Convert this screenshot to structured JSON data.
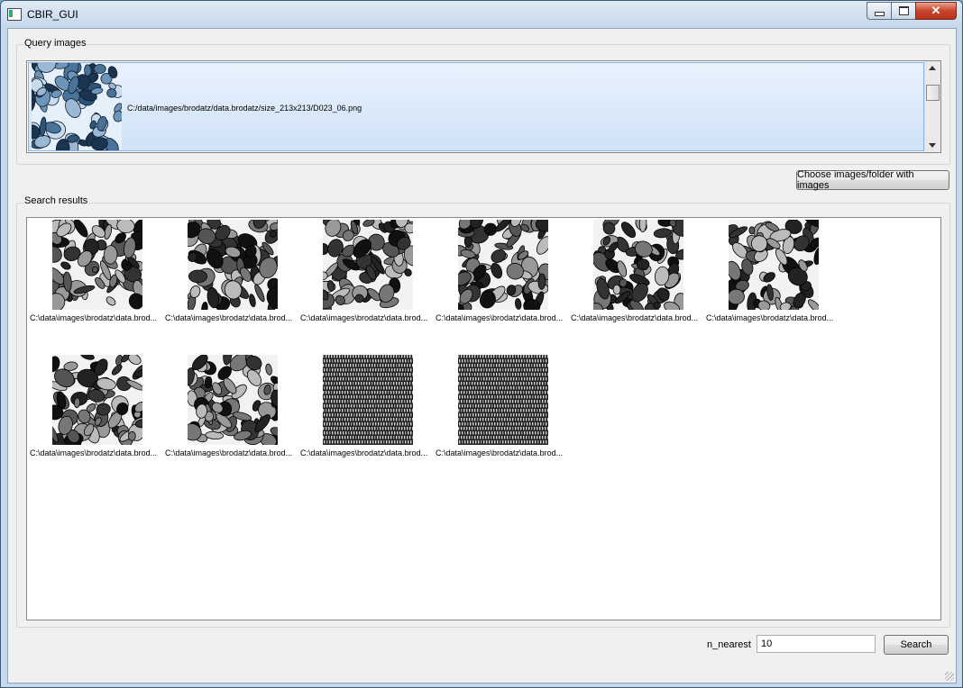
{
  "window": {
    "title": "CBIR_GUI",
    "close_glyph": "✕"
  },
  "query": {
    "group_title": "Query images",
    "items": [
      {
        "path": "C:/data/images/brodatz/data.brodatz/size_213x213/D023_06.png",
        "icon": "pebbles-texture-blue"
      }
    ]
  },
  "choose_button": "Choose images/folder with images",
  "results": {
    "group_title": "Search results",
    "items": [
      {
        "label": "C:\\data\\images\\brodatz\\data.brod...",
        "texture": "pebbles"
      },
      {
        "label": "C:\\data\\images\\brodatz\\data.brod...",
        "texture": "pebbles"
      },
      {
        "label": "C:\\data\\images\\brodatz\\data.brod...",
        "texture": "pebbles"
      },
      {
        "label": "C:\\data\\images\\brodatz\\data.brod...",
        "texture": "pebbles"
      },
      {
        "label": "C:\\data\\images\\brodatz\\data.brod...",
        "texture": "pebbles"
      },
      {
        "label": "C:\\data\\images\\brodatz\\data.brod...",
        "texture": "pebbles"
      },
      {
        "label": "C:\\data\\images\\brodatz\\data.brod...",
        "texture": "pebbles"
      },
      {
        "label": "C:\\data\\images\\brodatz\\data.brod...",
        "texture": "pebbles"
      },
      {
        "label": "C:\\data\\images\\brodatz\\data.brod...",
        "texture": "woven"
      },
      {
        "label": "C:\\data\\images\\brodatz\\data.brod...",
        "texture": "woven"
      }
    ]
  },
  "controls": {
    "n_nearest_label": "n_nearest",
    "n_nearest_value": "10",
    "search_label": "Search"
  }
}
